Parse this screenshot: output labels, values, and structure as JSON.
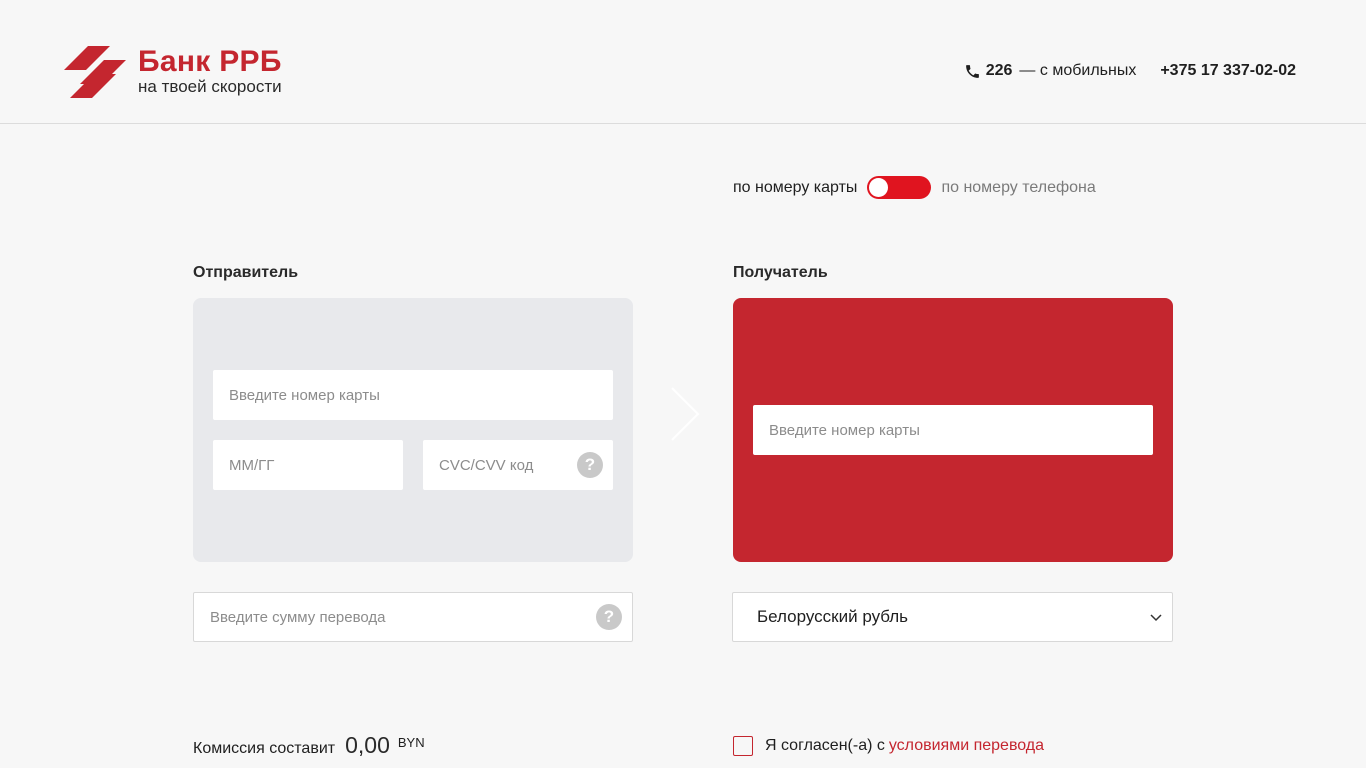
{
  "header": {
    "logo": {
      "name": "Банк РРБ",
      "slogan": "на твоей скорости"
    },
    "contacts": {
      "short_number": "226",
      "short_note": "— с мобильных",
      "long_number": "+375 17 337-02-02"
    }
  },
  "mode_switch": {
    "left_label": "по номеру карты",
    "right_label": "по номеру телефона",
    "state": "card"
  },
  "sender": {
    "title": "Отправитель",
    "card_number_placeholder": "Введите номер карты",
    "expiry_placeholder": "ММ/ГГ",
    "cvc_placeholder": "CVC/CVV код",
    "help_glyph": "?"
  },
  "receiver": {
    "title": "Получатель",
    "card_number_placeholder": "Введите номер карты"
  },
  "amount": {
    "placeholder": "Введите сумму перевода",
    "help_glyph": "?"
  },
  "currency": {
    "selected": "Белорусский рубль"
  },
  "commission": {
    "label": "Комиссия составит",
    "value": "0,00",
    "currency": "BYN"
  },
  "agreement": {
    "text": "Я согласен(-а) с",
    "link": "условиями перевода",
    "checked": false
  },
  "colors": {
    "brand": "#c4262f",
    "toggle": "#e0141f",
    "sender_card": "#e8e9ec"
  },
  "icons": [
    "phone-icon",
    "help-icon",
    "chevron-right-icon",
    "chevron-down-icon",
    "checkbox-icon"
  ]
}
